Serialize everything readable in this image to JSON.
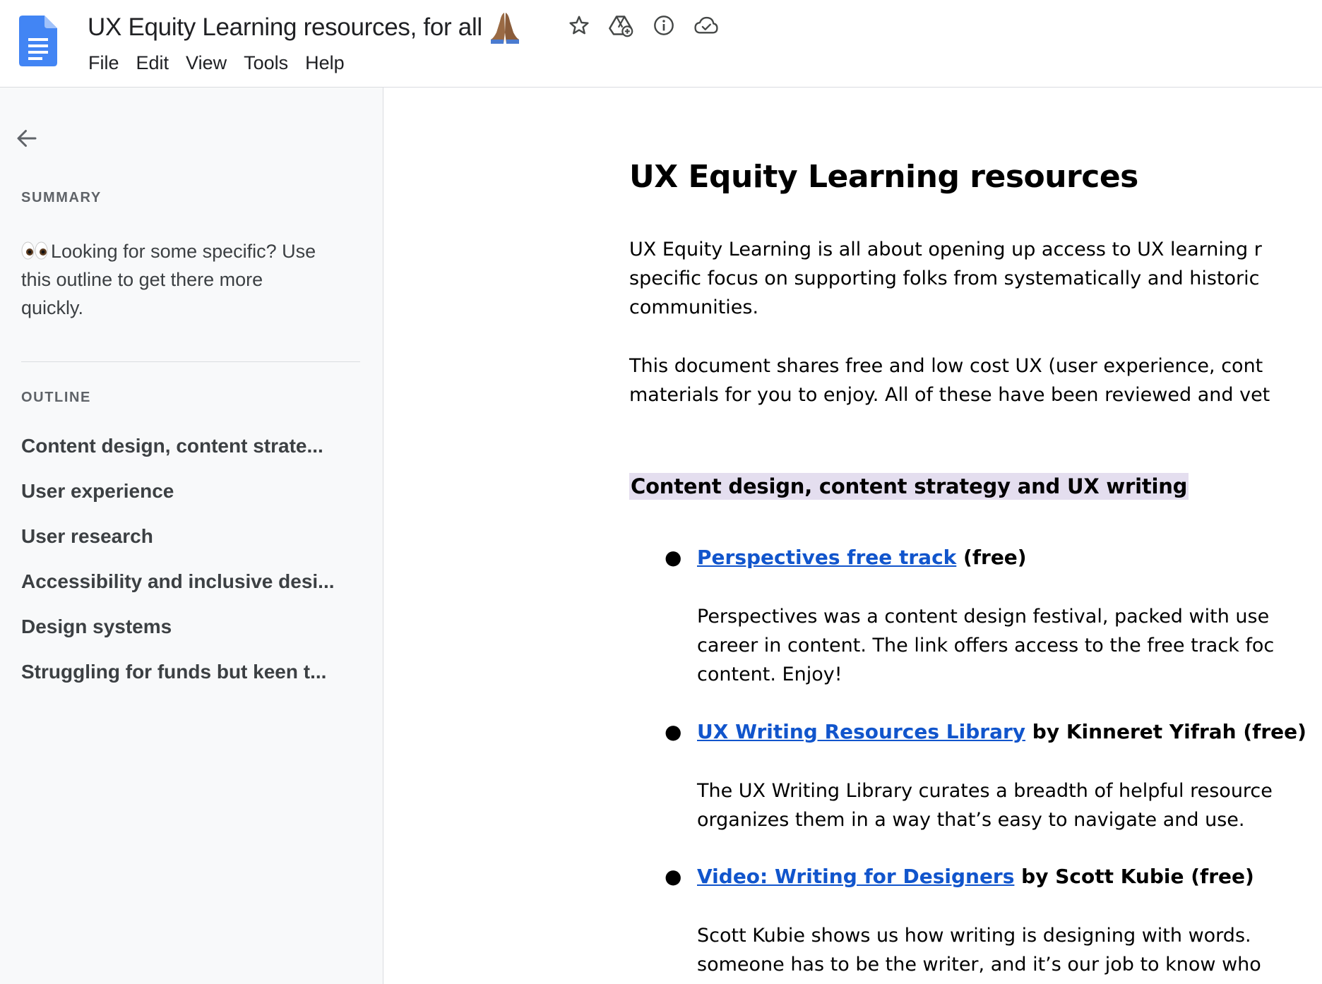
{
  "header": {
    "title": "UX Equity Learning resources, for all",
    "title_emoji": "pray-hands-icon",
    "icons": [
      "star-icon",
      "move-to-drive-icon",
      "info-icon",
      "cloud-saved-icon"
    ],
    "menu": [
      "File",
      "Edit",
      "View",
      "Tools",
      "Help"
    ]
  },
  "sidebar": {
    "summary_label": "SUMMARY",
    "summary_text": "Looking for some specific? Use this outline to get there more quickly.",
    "summary_line1": "Looking for some specific? Use",
    "summary_line2": "this outline to get there more",
    "summary_line3": "quickly.",
    "outline_label": "OUTLINE",
    "outline_items": [
      "Content design, content strate...",
      "User experience",
      "User research",
      "Accessibility and inclusive desi...",
      "Design systems",
      "Struggling for funds but keen t..."
    ]
  },
  "document": {
    "heading": "UX Equity Learning resources",
    "intro1_lines": [
      "UX Equity Learning is all about opening up access to UX learning r",
      "specific focus on supporting folks from systematically and historic",
      "communities."
    ],
    "intro2_lines": [
      "This document shares free and low cost UX (user experience, cont",
      "materials for you to enjoy. All of these have been reviewed and vet"
    ],
    "section_heading": "Content design, content strategy and UX writing",
    "resources": [
      {
        "link": "Perspectives free track",
        "suffix": " (free)",
        "desc_lines": [
          "Perspectives was a content design festival, packed with use",
          "career in content. The link offers access to the free track foc",
          "content. Enjoy!"
        ]
      },
      {
        "link": "UX Writing Resources Library",
        "suffix": " by Kinneret Yifrah (free)",
        "desc_lines": [
          "The UX Writing Library curates a breadth of helpful resource",
          "organizes them in a way that’s easy to navigate and use."
        ]
      },
      {
        "link": "Video: Writing for Designers",
        "suffix": " by Scott Kubie (free)",
        "desc_lines": [
          "Scott Kubie shows us how writing is designing with words.",
          "someone has to be the writer, and it’s our job to know who"
        ]
      }
    ]
  },
  "colors": {
    "link": "#1155cc",
    "heading_highlight": "#e4deef",
    "sidebar_bg": "#f8f9fa",
    "docs_blue": "#4285f4"
  }
}
